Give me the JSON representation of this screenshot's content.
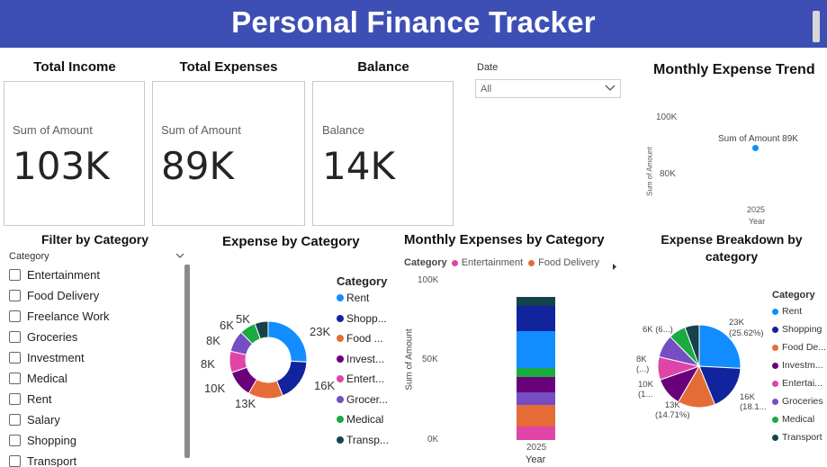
{
  "banner": {
    "title": "Personal Finance Tracker"
  },
  "kpis": [
    {
      "title": "Total Income",
      "label": "Sum of Amount",
      "value": "103K"
    },
    {
      "title": "Total Expenses",
      "label": "Sum of Amount",
      "value": "89K"
    },
    {
      "title": "Balance",
      "label": "Balance",
      "value": "14K"
    }
  ],
  "date_slicer": {
    "label": "Date",
    "value": "All"
  },
  "trend": {
    "title": "Monthly Expense Trend",
    "ylabel": "Sum of Amount",
    "xlabel": "Year",
    "y_ticks": [
      "100K",
      "80K"
    ],
    "x_tick": "2025",
    "point_label": "Sum of Amount 89K"
  },
  "filter": {
    "title": "Filter by Category",
    "header": "Category",
    "items": [
      "Entertainment",
      "Food Delivery",
      "Freelance Work",
      "Groceries",
      "Investment",
      "Medical",
      "Rent",
      "Salary",
      "Shopping",
      "Transport"
    ]
  },
  "donut": {
    "title": "Expense by Category",
    "legend_title": "Category",
    "legend": [
      "Rent",
      "Shopp...",
      "Food ...",
      "Invest...",
      "Entert...",
      "Grocer...",
      "Medical",
      "Transp..."
    ],
    "labels": [
      "23K",
      "16K",
      "13K",
      "10K",
      "8K",
      "8K",
      "6K",
      "5K"
    ]
  },
  "stacked": {
    "title": "Monthly Expenses by Category",
    "legend_title": "Category",
    "legend": [
      "Entertainment",
      "Food Delivery"
    ],
    "y_ticks": [
      "100K",
      "50K",
      "0K"
    ],
    "ylabel": "Sum of Amount",
    "x_tick": "2025",
    "xlabel": "Year"
  },
  "pie": {
    "title_line1": "Expense Breakdown by",
    "title_line2": "category",
    "legend_title": "Category",
    "legend": [
      "Rent",
      "Shopping",
      "Food De...",
      "Investm...",
      "Entertai...",
      "Groceries",
      "Medical",
      "Transport"
    ],
    "labels": {
      "rent_a": "23K",
      "rent_b": "(25.62%)",
      "shop_a": "16K",
      "shop_b": "(18.1...",
      "food_a": "13K",
      "food_b": "(14.71%)",
      "inv_a": "10K",
      "inv_b": "(1...",
      "ent_a": "8K",
      "ent_b": "(...)",
      "med": "6K (6...)"
    }
  },
  "colors": {
    "banner": "#3d4fb5",
    "rent": "#118dff",
    "shopping": "#12239e",
    "food": "#e66c37",
    "investment": "#6b007b",
    "entertainment": "#e044a7",
    "groceries": "#744ec2",
    "medical": "#1aab40",
    "transport": "#15434a"
  },
  "chart_data": {
    "type": "pie",
    "title": "Expense by Category",
    "categories": [
      "Rent",
      "Shopping",
      "Food Delivery",
      "Investment",
      "Entertainment",
      "Groceries",
      "Medical",
      "Transport"
    ],
    "values": [
      23,
      16,
      13,
      10,
      8,
      8,
      6,
      5
    ]
  }
}
